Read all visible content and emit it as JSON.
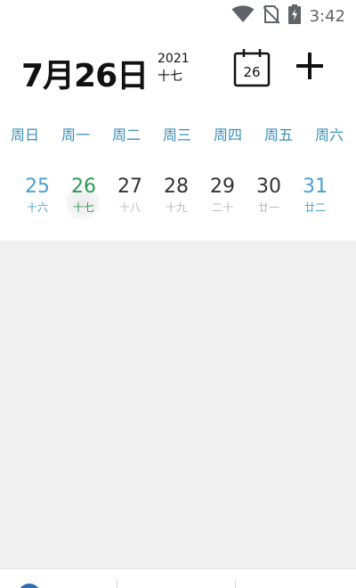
{
  "status_bar": {
    "time": "3:42",
    "icons": [
      "wifi-icon",
      "no-sim-icon",
      "battery-charging-icon"
    ]
  },
  "header": {
    "date_title": "7月26日",
    "year": "2021",
    "lunar_day": "十七",
    "calendar_button_day": "26",
    "add_icon": "plus-icon"
  },
  "week": {
    "weekdays": [
      "周日",
      "周一",
      "周二",
      "周三",
      "周四",
      "周五",
      "周六"
    ],
    "days": [
      {
        "num": "25",
        "lunar": "十六"
      },
      {
        "num": "26",
        "lunar": "十七"
      },
      {
        "num": "27",
        "lunar": "十八"
      },
      {
        "num": "28",
        "lunar": "十九"
      },
      {
        "num": "29",
        "lunar": "二十"
      },
      {
        "num": "30",
        "lunar": "廿一"
      },
      {
        "num": "31",
        "lunar": "廿二"
      }
    ]
  },
  "colors": {
    "weekday_text": "#3a8fb7",
    "weekend_date": "#4a9fd0",
    "today_date": "#2e9a56",
    "content_bg": "#f0f0f0"
  }
}
